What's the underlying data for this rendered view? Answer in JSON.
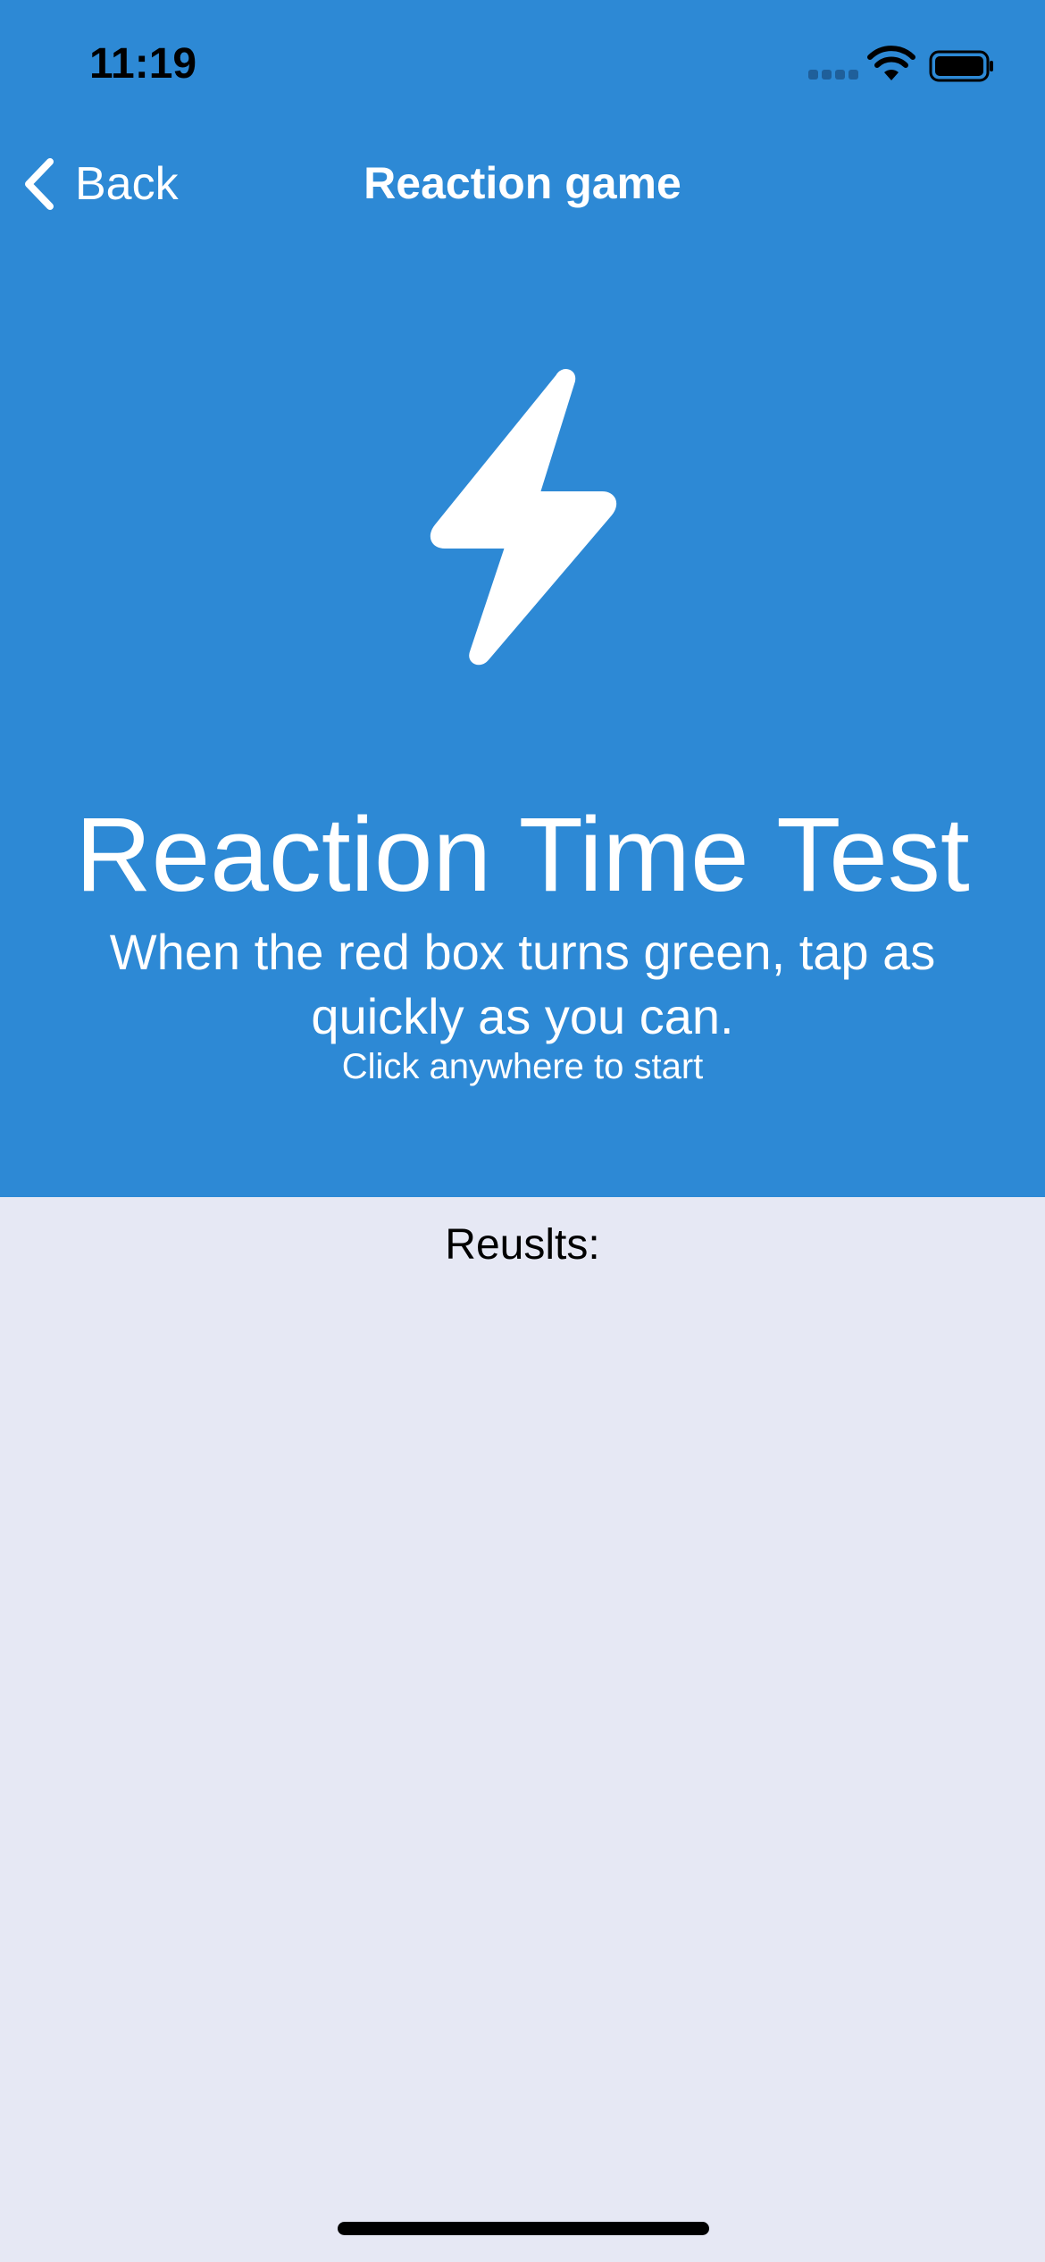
{
  "status_bar": {
    "time": "11:19"
  },
  "nav": {
    "back_label": "Back",
    "title": "Reaction game"
  },
  "hero": {
    "icon": "bolt-icon",
    "title": "Reaction Time Test",
    "description": "When the red box turns green, tap as quickly as you can.",
    "hint": "Click anywhere to start"
  },
  "results": {
    "label": "Reuslts:"
  },
  "colors": {
    "panel": "#2d89d5",
    "background": "#e6e8f4",
    "text_on_panel": "#ffffff"
  }
}
